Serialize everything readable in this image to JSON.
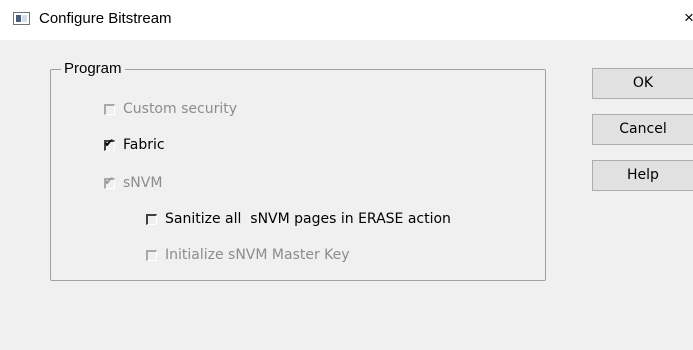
{
  "dialog": {
    "title": "Configure Bitstream",
    "close_glyph": "×"
  },
  "group": {
    "label": "Program",
    "options": [
      {
        "label": "Custom security",
        "checked": false,
        "enabled": false
      },
      {
        "label": "Fabric",
        "checked": true,
        "enabled": true
      },
      {
        "label": "sNVM",
        "checked": true,
        "enabled": false
      },
      {
        "label": "Sanitize all  sNVM pages in ERASE action",
        "checked": false,
        "enabled": true
      },
      {
        "label": "Initialize sNVM Master Key",
        "checked": false,
        "enabled": false
      }
    ]
  },
  "buttons": {
    "ok": "OK",
    "cancel": "Cancel",
    "help": "Help"
  },
  "icons": {
    "window": "window-icon",
    "checkmark": "checkmark-icon"
  },
  "colors": {
    "background": "#f0f0f0",
    "titlebar": "#ffffff",
    "button_face": "#e1e1e1",
    "button_border": "#adadad",
    "disabled_text": "#8c8c8c"
  }
}
